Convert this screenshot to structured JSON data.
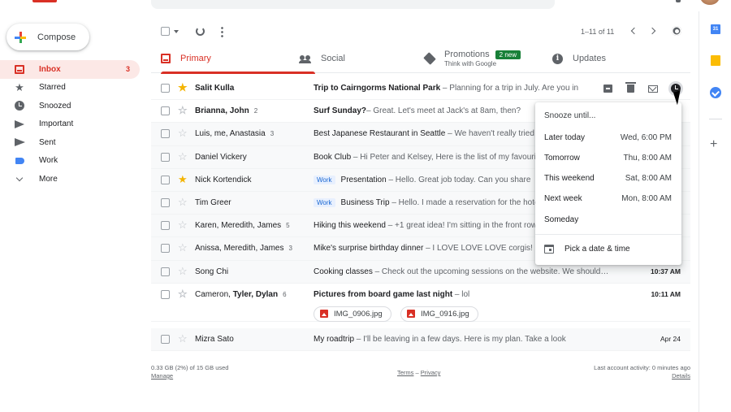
{
  "compose": {
    "label": "Compose"
  },
  "nav": {
    "items": [
      {
        "label": "Inbox",
        "count": "3",
        "icon": "inbox-icon",
        "active": true
      },
      {
        "label": "Starred",
        "icon": "star-icon"
      },
      {
        "label": "Snoozed",
        "icon": "clock-icon"
      },
      {
        "label": "Important",
        "icon": "important-icon"
      },
      {
        "label": "Sent",
        "icon": "send-icon"
      },
      {
        "label": "Work",
        "icon": "label-icon",
        "color": "#4285f4"
      },
      {
        "label": "More",
        "icon": "chevron-down-icon"
      }
    ]
  },
  "toolbar": {
    "range": "1–11 of 11"
  },
  "tabs": {
    "primary": "Primary",
    "social": "Social",
    "promotions": "Promotions",
    "promotions_badge": "2 new",
    "promotions_sub": "Think with Google",
    "updates": "Updates"
  },
  "emails": [
    {
      "sender": "Salit Kulla",
      "subject": "Trip to Cairngorms National Park",
      "snippet": " – Planning for a trip in July. Are you in",
      "starred": true,
      "unread": true
    },
    {
      "sender": "Brianna, John",
      "count": "2",
      "subject": "Surf Sunday?",
      "snippet": "– Great. Let's meet at Jack's at 8am, then?",
      "unread": true
    },
    {
      "sender": "Luis, me, Anastasia",
      "count": "3",
      "subject": "Best Japanese Restaurant in Seattle",
      "snippet": " – We haven't really tried"
    },
    {
      "sender": "Daniel Vickery",
      "subject": "Book Club",
      "snippet": " – Hi Peter and Kelsey, Here is the list of my favourite"
    },
    {
      "sender": "Nick Kortendick",
      "label": "Work",
      "subject": "Presentation",
      "snippet": " – Hello. Great job today. Can you share",
      "starred": true
    },
    {
      "sender": "Tim Greer",
      "label": "Work",
      "subject": "Business Trip",
      "snippet": " – Hello. I made a reservation for the hotel"
    },
    {
      "sender": "Karen, Meredith, James",
      "count": "5",
      "subject": "Hiking this weekend",
      "snippet": " – +1 great idea! I'm sitting in the front row"
    },
    {
      "sender": "Anissa, Meredith, James",
      "count": "3",
      "subject": "Mike's surprise birthday dinner",
      "snippet": " – I LOVE LOVE LOVE corgis! Can"
    },
    {
      "sender": "Song Chi",
      "subject": "Cooking classes",
      "snippet": " – Check out the upcoming sessions on the website. We should…",
      "date": "10:37 AM"
    },
    {
      "sender": "Cameron, ",
      "sender_bold": "Tyler, Dylan",
      "count": "6",
      "subject": "Pictures from board game last night",
      "snippet": " – lol",
      "date": "10:11 AM",
      "unread": true,
      "attachments": [
        "IMG_0906.jpg",
        "IMG_0916.jpg"
      ]
    },
    {
      "sender": "Mizra Sato",
      "subject": "My roadtrip",
      "snippet": " – I'll be leaving in a few days. Here is my plan. Take a look",
      "date": "Apr 24"
    }
  ],
  "snooze_menu": {
    "title": "Snooze until...",
    "options": [
      {
        "label": "Later today",
        "time": "Wed, 6:00 PM"
      },
      {
        "label": "Tomorrow",
        "time": "Thu, 8:00 AM"
      },
      {
        "label": "This weekend",
        "time": "Sat, 8:00 AM"
      },
      {
        "label": "Next week",
        "time": "Mon, 8:00 AM"
      },
      {
        "label": "Someday",
        "time": ""
      }
    ],
    "pick": "Pick a date & time"
  },
  "footer": {
    "storage": "0.33 GB (2%) of 15 GB used",
    "manage": "Manage",
    "terms": "Terms",
    "sep": "–",
    "privacy": "Privacy",
    "activity": "Last account activity: 0 minutes ago",
    "details": "Details"
  },
  "side_panel": {
    "calendar_day": "31"
  }
}
